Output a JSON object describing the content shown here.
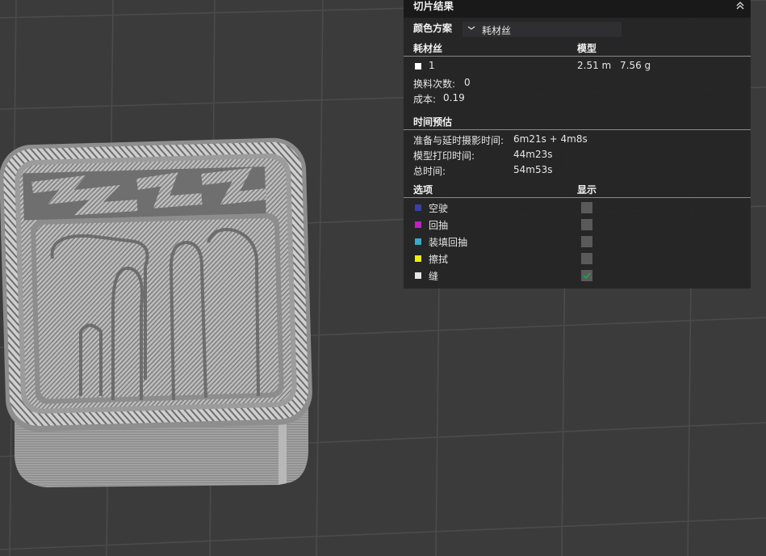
{
  "panel": {
    "title": "切片结果",
    "color_scheme_label": "颜色方案",
    "color_scheme_value": "耗材丝",
    "filament_header": "耗材丝",
    "model_header": "模型",
    "filament": {
      "id": "1",
      "length": "2.51 m",
      "weight": "7.56 g",
      "color": "#ffffff"
    },
    "change_count_label": "换料次数:",
    "change_count_value": "0",
    "cost_label": "成本:",
    "cost_value": "0.19",
    "time_header": "时间预估",
    "prep_label": "准备与延时摄影时间:",
    "prep_value": "6m21s + 4m8s",
    "print_label": "模型打印时间:",
    "print_value": "44m23s",
    "total_label": "总时间:",
    "total_value": "54m53s",
    "options_header": "选项",
    "display_header": "显示",
    "options": [
      {
        "label": "空驶",
        "color": "#3a3fa8",
        "checked": false
      },
      {
        "label": "回抽",
        "color": "#c21fc2",
        "checked": false
      },
      {
        "label": "装填回抽",
        "color": "#3ba9c9",
        "checked": false
      },
      {
        "label": "擦拭",
        "color": "#f0f000",
        "checked": false
      },
      {
        "label": "缝",
        "color": "#e6e6e6",
        "checked": true
      }
    ]
  },
  "colors": {
    "background": "#3b3b3b",
    "grid": "#4a4a4a",
    "model": "#9a9a9a",
    "check": "#19a34a"
  },
  "icons": {
    "collapse": "double-chevron-up-icon",
    "dropdown": "chevron-down-icon",
    "check": "check-icon"
  }
}
